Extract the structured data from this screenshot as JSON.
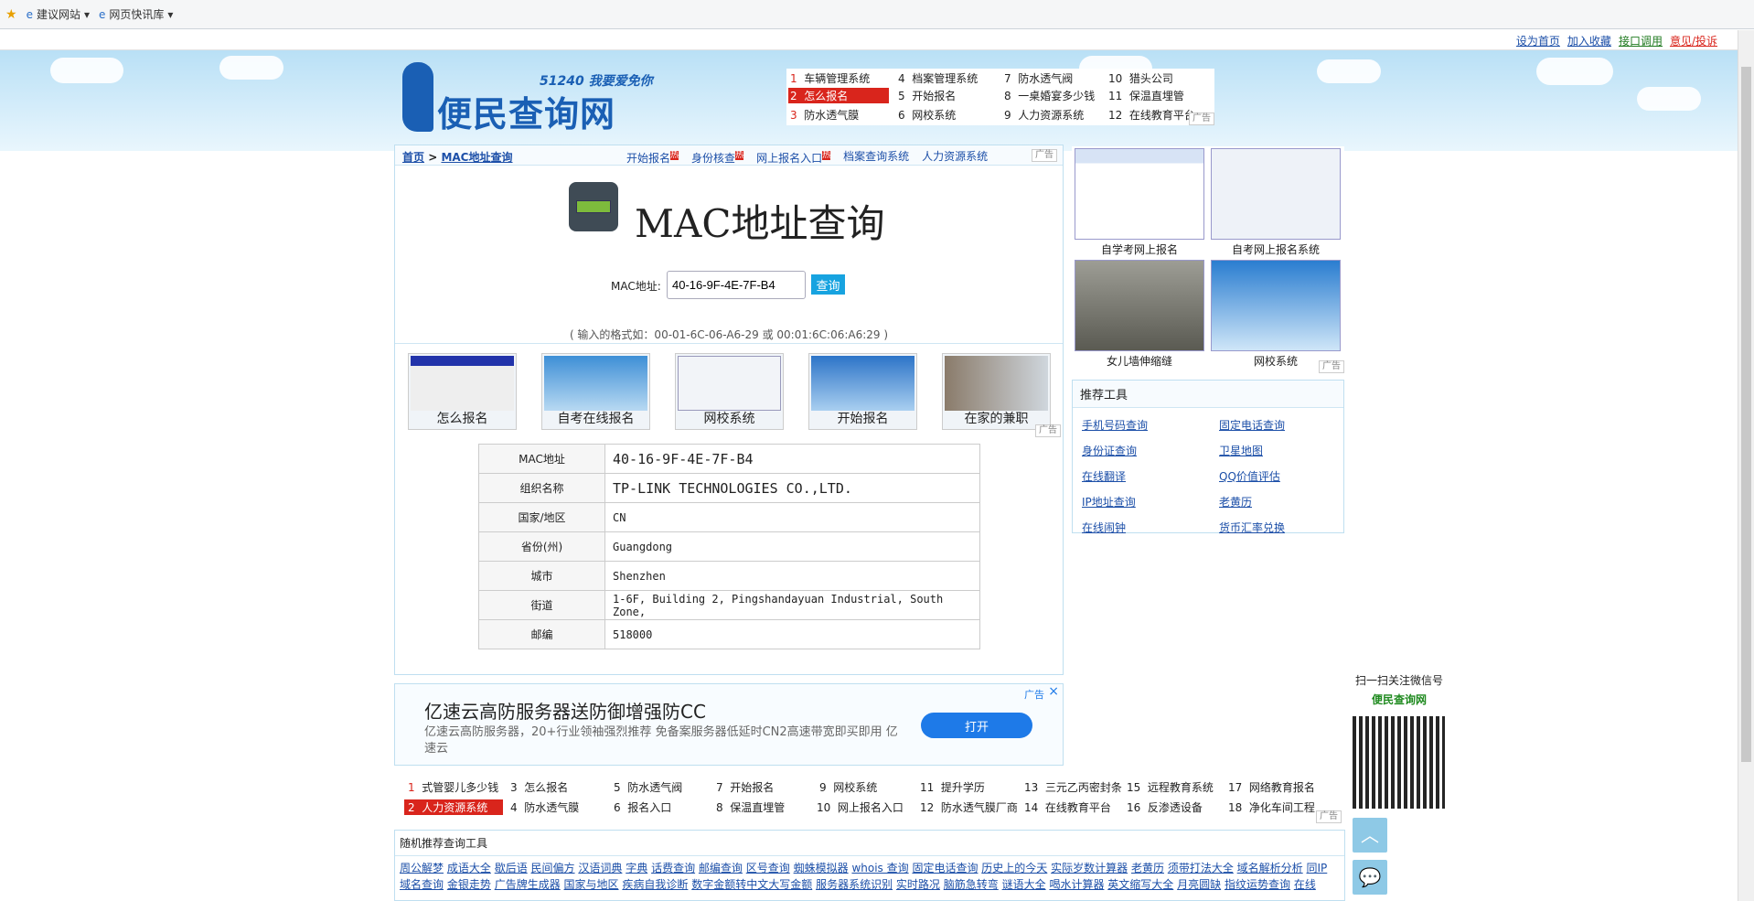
{
  "favbar": {
    "item1": "建议网站",
    "item2": "网页快讯库"
  },
  "toplinks": [
    "设为首页",
    "加入收藏",
    "接口调用",
    "意见/投诉"
  ],
  "logo": {
    "top_text": "51240 我要爱免你",
    "name": "便民查询网"
  },
  "hot_top": [
    [
      "1",
      "车辆管理系统"
    ],
    [
      "2",
      "怎么报名"
    ],
    [
      "3",
      "防水透气膜"
    ],
    [
      "4",
      "档案管理系统"
    ],
    [
      "5",
      "开始报名"
    ],
    [
      "6",
      "网校系统"
    ],
    [
      "7",
      "防水透气阀"
    ],
    [
      "8",
      "一桌婚宴多少钱"
    ],
    [
      "9",
      "人力资源系统"
    ],
    [
      "10",
      "猎头公司"
    ],
    [
      "11",
      "保温直埋管"
    ],
    [
      "12",
      "在线教育平台"
    ]
  ],
  "breadcrumb": {
    "home": "首页",
    "sep": ">",
    "current": "MAC地址查询"
  },
  "nav_links": [
    "开始报名",
    "身份核查",
    "网上报名入口",
    "档案查询系统",
    "人力资源系统"
  ],
  "hot_badge": "热",
  "ad_label": "广告",
  "page_title": "MAC地址查询",
  "search": {
    "label": "MAC地址:",
    "value": "40-16-9F-4E-7F-B4",
    "button": "查询",
    "hint": "( 输入的格式如：00-01-6C-06-A6-29 或 00:01:6C:06:A6:29 )"
  },
  "thumbs": [
    "怎么报名",
    "自考在线报名",
    "网校系统",
    "开始报名",
    "在家的兼职"
  ],
  "result": [
    {
      "k": "MAC地址",
      "v": "40-16-9F-4E-7F-B4"
    },
    {
      "k": "组织名称",
      "v": "TP-LINK TECHNOLOGIES CO.,LTD."
    },
    {
      "k": "国家/地区",
      "v": "CN"
    },
    {
      "k": "省份(州)",
      "v": "Guangdong"
    },
    {
      "k": "城市",
      "v": "Shenzhen"
    },
    {
      "k": "街道",
      "v": "1-6F, Building 2, Pingshandayuan Industrial, South Zone,"
    },
    {
      "k": "邮编",
      "v": "518000"
    }
  ],
  "ad_big": {
    "title": "亿速云高防服务器送防御增强防CC",
    "desc": "亿速云高防服务器，20+行业领袖强烈推荐 免备案服务器低延时CN2高速带宽即买即用 亿速云",
    "button": "打开",
    "tag": "广告"
  },
  "right_thumbs": [
    "自学考网上报名",
    "自考网上报名系统",
    "女儿墙伸缩缝",
    "网校系统"
  ],
  "tools": {
    "title": "推荐工具",
    "items": [
      "手机号码查询",
      "固定电话查询",
      "身份证查询",
      "卫星地图",
      "在线翻译",
      "QQ价值评估",
      "IP地址查询",
      "老黄历",
      "在线闹钟",
      "货币汇率兑换"
    ]
  },
  "hot_bottom": [
    [
      "1",
      "式管婴儿多少钱"
    ],
    [
      "2",
      "人力资源系统"
    ],
    [
      "3",
      "怎么报名"
    ],
    [
      "4",
      "防水透气膜"
    ],
    [
      "5",
      "防水透气阀"
    ],
    [
      "6",
      "报名入口"
    ],
    [
      "7",
      "开始报名"
    ],
    [
      "8",
      "保温直埋管"
    ],
    [
      "9",
      "网校系统"
    ],
    [
      "10",
      "网上报名入口"
    ],
    [
      "11",
      "提升学历"
    ],
    [
      "12",
      "防水透气膜厂商"
    ],
    [
      "13",
      "三元乙丙密封条"
    ],
    [
      "14",
      "在线教育平台"
    ],
    [
      "15",
      "远程教育系统"
    ],
    [
      "16",
      "反渗透设备"
    ],
    [
      "17",
      "网络教育报名"
    ],
    [
      "18",
      "净化车间工程"
    ]
  ],
  "random_tools": {
    "title": "随机推荐查询工具",
    "links": [
      "周公解梦",
      "成语大全",
      "歇后语",
      "民间偏方",
      "汉语词典",
      "字典",
      "话费查询",
      "邮编查询",
      "区号查询",
      "蜘蛛模拟器",
      "whois 查询",
      "固定电话查询",
      "历史上的今天",
      "实际岁数计算器",
      "老黄历",
      "须带打法大全",
      "域名解析分析",
      "同IP",
      "域名查询",
      "金银走势",
      "广告牌生成器",
      "国家与地区",
      "疾病自我诊断",
      "数字金额转中文大写金额",
      "服务器系统识别",
      "实时路况",
      "脑筋急转弯",
      "谜语大全",
      "喝水计算器",
      "英文缩写大全",
      "月亮圆缺",
      "指纹运势查询",
      "在线"
    ]
  },
  "wechat": {
    "line1": "扫一扫关注微信号",
    "line2": "便民查询网"
  },
  "colors": {
    "accent": "#17a3e0",
    "red": "#d9251c",
    "link": "#1c4fa8"
  }
}
